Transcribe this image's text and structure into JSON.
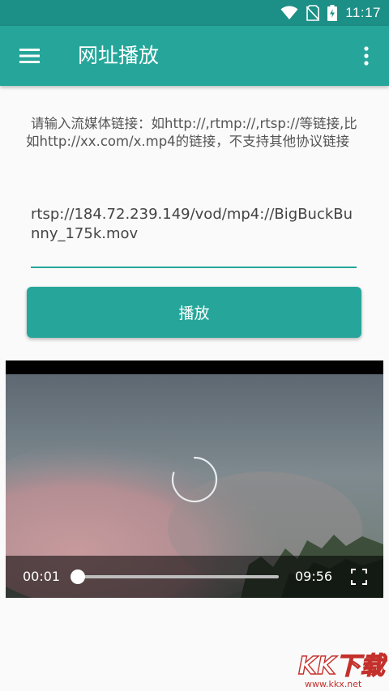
{
  "status_bar": {
    "time": "11:17",
    "icons": [
      "wifi-icon",
      "no-sim-icon",
      "battery-charging-icon"
    ]
  },
  "app_bar": {
    "title": "网址播放",
    "menu_icon": "hamburger-menu-icon",
    "overflow_icon": "more-vert-icon"
  },
  "form": {
    "hint": "请输入流媒体链接：如http://,rtmp://,rtsp://等链接,比如http://xx.com/x.mp4的链接，不支持其他协议链接",
    "url_value": "rtsp://184.72.239.149/vod/mp4://BigBuckBunny_175k.mov",
    "play_label": "播放"
  },
  "player": {
    "current_time": "00:01",
    "duration": "09:56",
    "progress": 0.002,
    "state": "loading",
    "fullscreen_icon": "fullscreen-icon",
    "spinner_icon": "loading-spinner-icon"
  },
  "colors": {
    "primary": "#26a69a",
    "primary_dark": "#1c8f86",
    "background": "#fafafa",
    "text_secondary": "#555555",
    "watermark": "#c4302b"
  },
  "watermark": {
    "brand": "KK下载",
    "site": "www.kkx.net"
  }
}
